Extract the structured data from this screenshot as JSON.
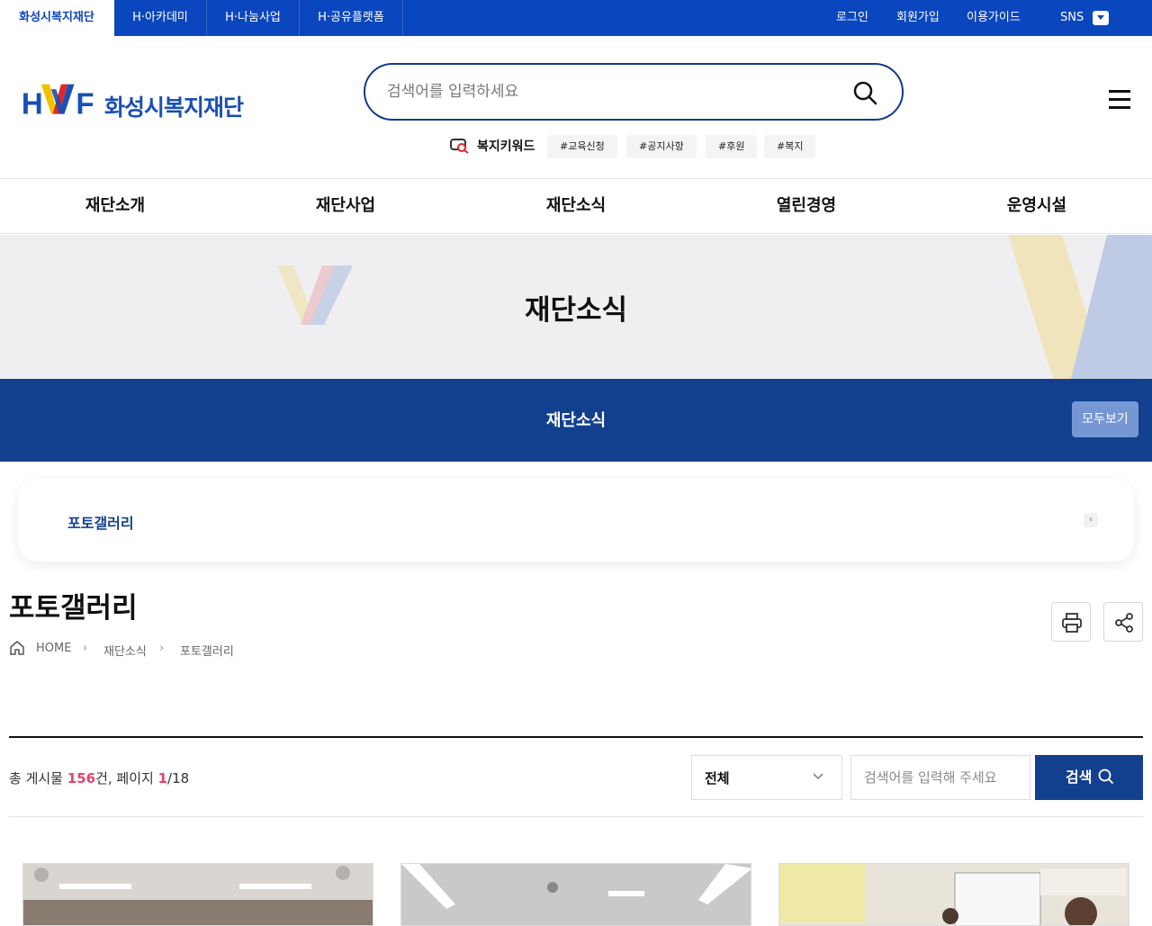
{
  "topbar": {
    "tabs": [
      {
        "label": "화성시복지재단",
        "active": true
      },
      {
        "label": "H·아카데미",
        "active": false
      },
      {
        "label": "H·나눔사업",
        "active": false
      },
      {
        "label": "H·공유플랫폼",
        "active": false
      }
    ],
    "utility": [
      "로그인",
      "회원가입",
      "이용가이드",
      "SNS"
    ]
  },
  "header": {
    "logo_text": "화성시복지재단",
    "logo_mark": "HWF",
    "search_placeholder": "검색어를 입력하세요",
    "keyword_label": "복지키워드",
    "keywords": [
      "#교육신청",
      "#공지사항",
      "#후원",
      "#복지"
    ]
  },
  "gnb": [
    "재단소개",
    "재단사업",
    "재단소식",
    "열린경영",
    "운영시설"
  ],
  "visual": {
    "title": "재단소식"
  },
  "subbar": {
    "title": "재단소식",
    "all_button": "모두보기"
  },
  "tabcard": {
    "label": "포토갤러리"
  },
  "page": {
    "title": "포토갤러리"
  },
  "breadcrumb": [
    "HOME",
    "재단소식",
    "포토갤러리"
  ],
  "board": {
    "total_prefix": "총 게시물 ",
    "total_count": "156",
    "total_suffix": "건, 페이지 ",
    "page_current": "1",
    "page_total": "/18",
    "filter_value": "전체",
    "search_placeholder": "검색어를 입력해 주세요",
    "search_button": "검색"
  },
  "colors": {
    "primary": "#0a46be",
    "navy": "#13408e",
    "highlight": "#e8406a"
  }
}
